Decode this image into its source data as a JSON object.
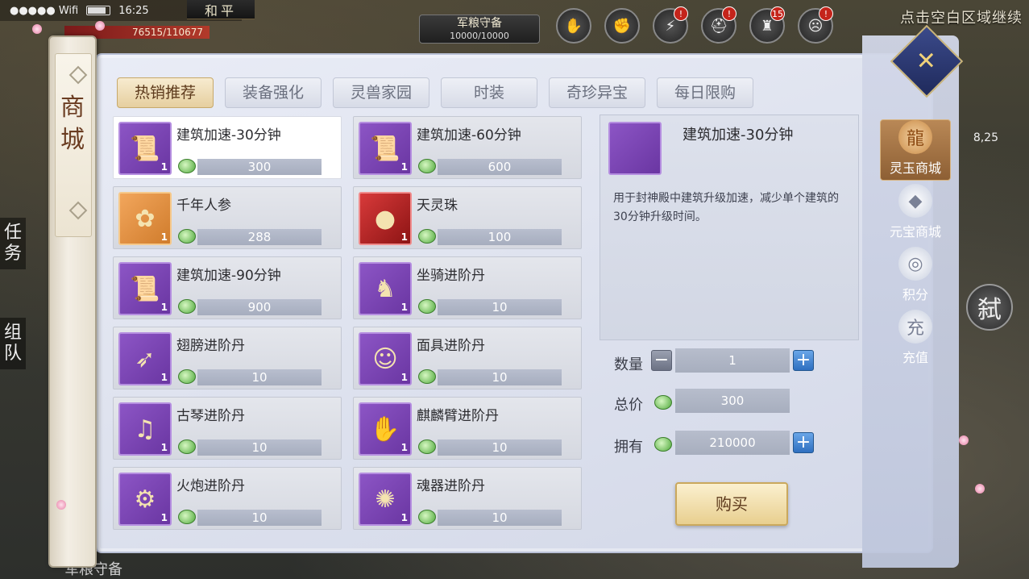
{
  "status": {
    "carrier": "●●●●● Wifi",
    "time": "16:25",
    "mode": "和平"
  },
  "hud": {
    "hp_text": "76515/110677",
    "grain_title": "军粮守备",
    "grain_value": "10000/10000",
    "hint": "点击空白区域继续",
    "coord": "8,25",
    "top_icons": [
      {
        "name": "handshake-icon",
        "glyph": "✋",
        "badge": ""
      },
      {
        "name": "fist-icon",
        "glyph": "✊",
        "badge": ""
      },
      {
        "name": "bolt-icon",
        "glyph": "⚡",
        "badge": "!"
      },
      {
        "name": "helmet-icon",
        "glyph": "⛑",
        "badge": "!"
      },
      {
        "name": "tower-icon",
        "glyph": "♜",
        "badge": "15"
      },
      {
        "name": "face-icon",
        "glyph": "☹",
        "badge": "!"
      }
    ],
    "left_tabs": [
      "任务",
      "组队"
    ],
    "skill_label": "弑",
    "bottom_text": "军粮守备"
  },
  "panel": {
    "title": "商城",
    "close_glyph": "✕",
    "tabs": [
      {
        "label": "热销推荐",
        "active": true
      },
      {
        "label": "装备强化",
        "active": false
      },
      {
        "label": "灵兽家园",
        "active": false
      },
      {
        "label": "时装",
        "active": false
      },
      {
        "label": "奇珍异宝",
        "active": false
      },
      {
        "label": "每日限购",
        "active": false
      }
    ],
    "items": [
      {
        "name": "建筑加速-30分钟",
        "price": "300",
        "qty": "1",
        "icon": "scroll-icon",
        "color": "purple",
        "selected": true
      },
      {
        "name": "建筑加速-60分钟",
        "price": "600",
        "qty": "1",
        "icon": "scroll-icon",
        "color": "purple",
        "selected": false
      },
      {
        "name": "千年人参",
        "price": "288",
        "qty": "1",
        "icon": "ginseng-icon",
        "color": "orange",
        "selected": false
      },
      {
        "name": "天灵珠",
        "price": "100",
        "qty": "1",
        "icon": "orb-icon",
        "color": "red",
        "selected": false
      },
      {
        "name": "建筑加速-90分钟",
        "price": "900",
        "qty": "1",
        "icon": "scroll-icon",
        "color": "purple",
        "selected": false
      },
      {
        "name": "坐骑进阶丹",
        "price": "10",
        "qty": "1",
        "icon": "horse-icon",
        "color": "purple",
        "selected": false
      },
      {
        "name": "翅膀进阶丹",
        "price": "10",
        "qty": "1",
        "icon": "feather-icon",
        "color": "purple",
        "selected": false
      },
      {
        "name": "面具进阶丹",
        "price": "10",
        "qty": "1",
        "icon": "mask-icon",
        "color": "purple",
        "selected": false
      },
      {
        "name": "古琴进阶丹",
        "price": "10",
        "qty": "1",
        "icon": "zither-icon",
        "color": "purple",
        "selected": false
      },
      {
        "name": "麒麟臂进阶丹",
        "price": "10",
        "qty": "1",
        "icon": "arm-icon",
        "color": "purple",
        "selected": false
      },
      {
        "name": "火炮进阶丹",
        "price": "10",
        "qty": "1",
        "icon": "cannon-icon",
        "color": "purple",
        "selected": false
      },
      {
        "name": "魂器进阶丹",
        "price": "10",
        "qty": "1",
        "icon": "amulet-icon",
        "color": "purple",
        "selected": false
      }
    ],
    "detail": {
      "title": "建筑加速-30分钟",
      "desc": "用于封神殿中建筑升级加速，减少单个建筑的30分钟升级时间。"
    },
    "purchase": {
      "qty_label": "数量",
      "qty_value": "1",
      "total_label": "总价",
      "total_value": "300",
      "owned_label": "拥有",
      "owned_value": "210000",
      "buy_label": "购买"
    },
    "side_tabs": [
      {
        "label": "灵玉商城",
        "glyph": "龍",
        "active": true
      },
      {
        "label": "元宝商城",
        "glyph": "◆",
        "active": false
      },
      {
        "label": "积分",
        "glyph": "◎",
        "active": false
      },
      {
        "label": "充值",
        "glyph": "充",
        "active": false
      }
    ]
  },
  "colors": {
    "accent": "#e6cf9f",
    "price_bar": "#a6adbe",
    "plus": "#2e6fc0"
  }
}
